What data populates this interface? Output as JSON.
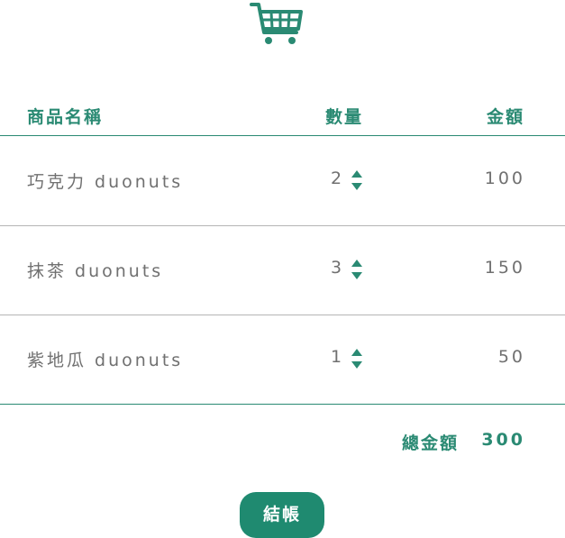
{
  "colors": {
    "accent": "#2a8a73",
    "button": "#1f8a70",
    "text_gray": "#707070",
    "divider": "#b5b5b5"
  },
  "cart": {
    "icon": "shopping-cart-icon"
  },
  "table": {
    "headers": {
      "name": "商品名稱",
      "qty": "數量",
      "amount": "金額"
    },
    "rows": [
      {
        "name": "巧克力 duonuts",
        "qty": "2",
        "amount": "100"
      },
      {
        "name": "抹茶 duonuts",
        "qty": "3",
        "amount": "150"
      },
      {
        "name": "紫地瓜 duonuts",
        "qty": "1",
        "amount": "50"
      }
    ]
  },
  "total": {
    "label": "總金額",
    "value": "300"
  },
  "checkout": {
    "label": "結帳"
  }
}
